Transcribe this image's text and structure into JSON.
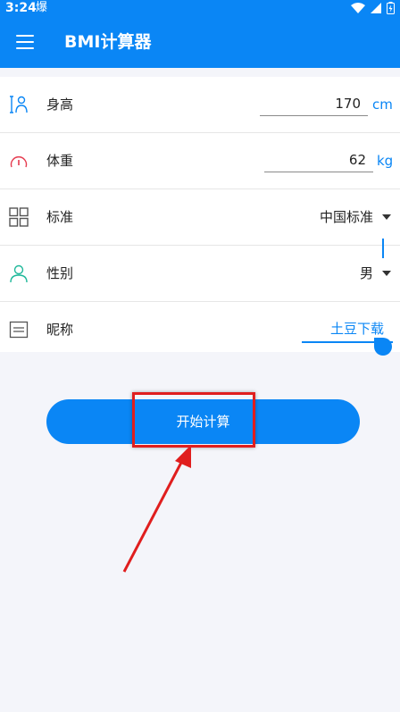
{
  "status_bar": {
    "time": "3:24",
    "app_glyph": "爆"
  },
  "app_bar": {
    "title": "BMI计算器"
  },
  "form": {
    "height": {
      "label": "身高",
      "value": "170",
      "unit": "cm"
    },
    "weight": {
      "label": "体重",
      "value": "62",
      "unit": "kg"
    },
    "standard": {
      "label": "标准",
      "selected": "中国标准"
    },
    "gender": {
      "label": "性别",
      "selected": "男"
    },
    "nickname": {
      "label": "昵称",
      "value": "土豆下载"
    }
  },
  "actions": {
    "start_label": "开始计算"
  },
  "colors": {
    "accent": "#0a86f5",
    "annotation": "#e01e1e",
    "background": "#f4f5fa"
  },
  "icons": [
    "menu-icon",
    "person-height-icon",
    "scale-icon",
    "grid-icon",
    "user-icon",
    "note-icon",
    "wifi-icon",
    "signal-icon",
    "battery-icon"
  ]
}
